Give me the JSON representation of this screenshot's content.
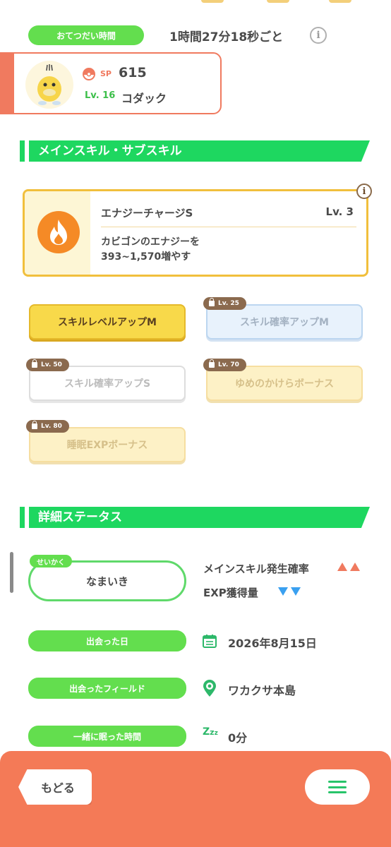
{
  "helper": {
    "label": "おてつだい時間",
    "value": "1時間27分18秒ごと"
  },
  "pokemon": {
    "sp_label": "SP",
    "sp_value": "615",
    "level": "Lv. 16",
    "name": "コダック"
  },
  "sections": {
    "skills_title": "メインスキル・サブスキル",
    "details_title": "詳細ステータス"
  },
  "main_skill": {
    "name": "エナジーチャージS",
    "level": "Lv. 3",
    "description_line1": "カビゴンのエナジーを",
    "description_line2": "393~1,570増やす"
  },
  "sub_skills": [
    {
      "label": "スキルレベルアップM",
      "lock": ""
    },
    {
      "label": "スキル確率アップM",
      "lock": "Lv. 25"
    },
    {
      "label": "スキル確率アップS",
      "lock": "Lv. 50"
    },
    {
      "label": "ゆめのかけらボーナス",
      "lock": "Lv. 70"
    },
    {
      "label": "睡眠EXPボーナス",
      "lock": "Lv. 80"
    }
  ],
  "nature": {
    "tag": "せいかく",
    "value": "なまいき",
    "up_stat": "メインスキル発生確率",
    "down_stat": "EXP獲得量"
  },
  "details": {
    "met_date_label": "出会った日",
    "met_date_value": "2026年8月15日",
    "met_field_label": "出会ったフィールド",
    "met_field_value": "ワカクサ本島",
    "slept_label": "一緒に眠った時間",
    "slept_value": "0分"
  },
  "nav": {
    "back_label": "もどる"
  },
  "colors": {
    "green": "#63de4e",
    "orange": "#f47a57",
    "gold": "#f1bf3c"
  }
}
